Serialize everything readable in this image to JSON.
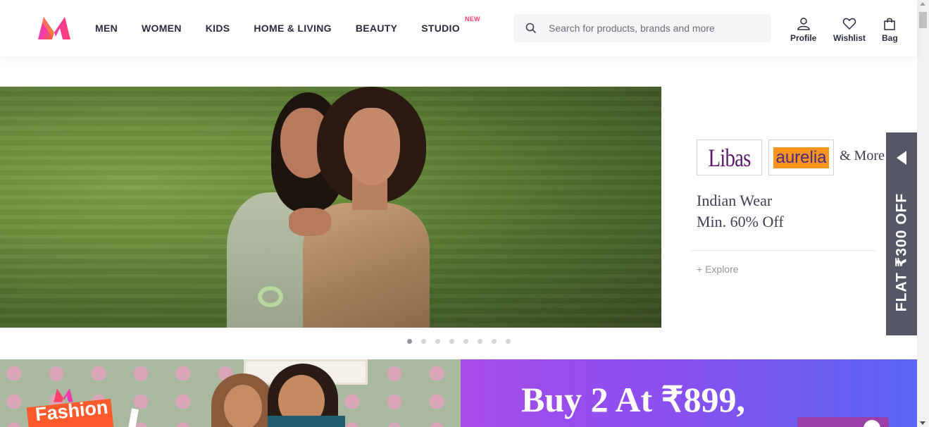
{
  "header": {
    "nav": [
      {
        "label": "MEN"
      },
      {
        "label": "WOMEN"
      },
      {
        "label": "KIDS"
      },
      {
        "label": "HOME & LIVING"
      },
      {
        "label": "BEAUTY"
      },
      {
        "label": "STUDIO",
        "badge": "NEW"
      }
    ],
    "search": {
      "placeholder": "Search for products, brands and more",
      "value": ""
    },
    "actions": [
      {
        "label": "Profile",
        "icon": "user-icon"
      },
      {
        "label": "Wishlist",
        "icon": "heart-icon"
      },
      {
        "label": "Bag",
        "icon": "bag-icon"
      }
    ]
  },
  "hero": {
    "brands": [
      "Libas",
      "aurelia"
    ],
    "more": "& More",
    "offer_line1": "Indian Wear",
    "offer_line2": "Min. 60% Off",
    "explore": "+ Explore",
    "dots_total": 8,
    "active_dot": 1
  },
  "flat_offer": "FLAT ₹300 OFF",
  "promos": {
    "left_text": "Fashion",
    "right_text": "Buy 2 At ₹899,"
  },
  "colors": {
    "accent": "#ff3f6c",
    "text": "#282c3f",
    "tab": "#535766"
  }
}
